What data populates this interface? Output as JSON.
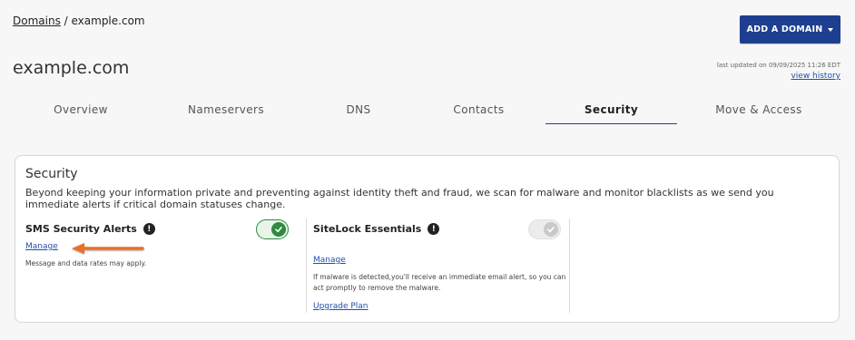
{
  "breadcrumb": {
    "root": "Domains",
    "separator": " / ",
    "current": "example.com"
  },
  "header": {
    "add_domain_label": "ADD A DOMAIN",
    "title": "example.com",
    "last_updated": "last updated on 09/09/2025 11:26 EDT",
    "view_history": "view history"
  },
  "tabs": [
    {
      "label": "Overview",
      "active": false
    },
    {
      "label": "Nameservers",
      "active": false
    },
    {
      "label": "DNS",
      "active": false
    },
    {
      "label": "Contacts",
      "active": false
    },
    {
      "label": "Security",
      "active": true
    },
    {
      "label": "Move & Access",
      "active": false
    }
  ],
  "security": {
    "title": "Security",
    "description": "Beyond keeping your information private and preventing against identity theft and fraud, we scan for malware and monitor blacklists as we send you immediate alerts if critical domain statuses change.",
    "sms": {
      "title": "SMS Security Alerts",
      "enabled": true,
      "manage": "Manage",
      "note": "Message and data rates may apply."
    },
    "sitelock": {
      "title": "SiteLock Essentials",
      "enabled": false,
      "manage": "Manage",
      "note": "If malware is detected,you'll receive an immediate email alert, so you can act promptly to remove the malware.",
      "upgrade": "Upgrade Plan"
    }
  },
  "colors": {
    "accent": "#1e3f8f",
    "toggle_on": "#2e8b3e",
    "arrow": "#e8702a",
    "link": "#1f4fa8"
  },
  "icons": {
    "info": "info-icon",
    "check": "check-icon",
    "caret": "chevron-down-icon",
    "arrow": "arrow-left-icon"
  }
}
